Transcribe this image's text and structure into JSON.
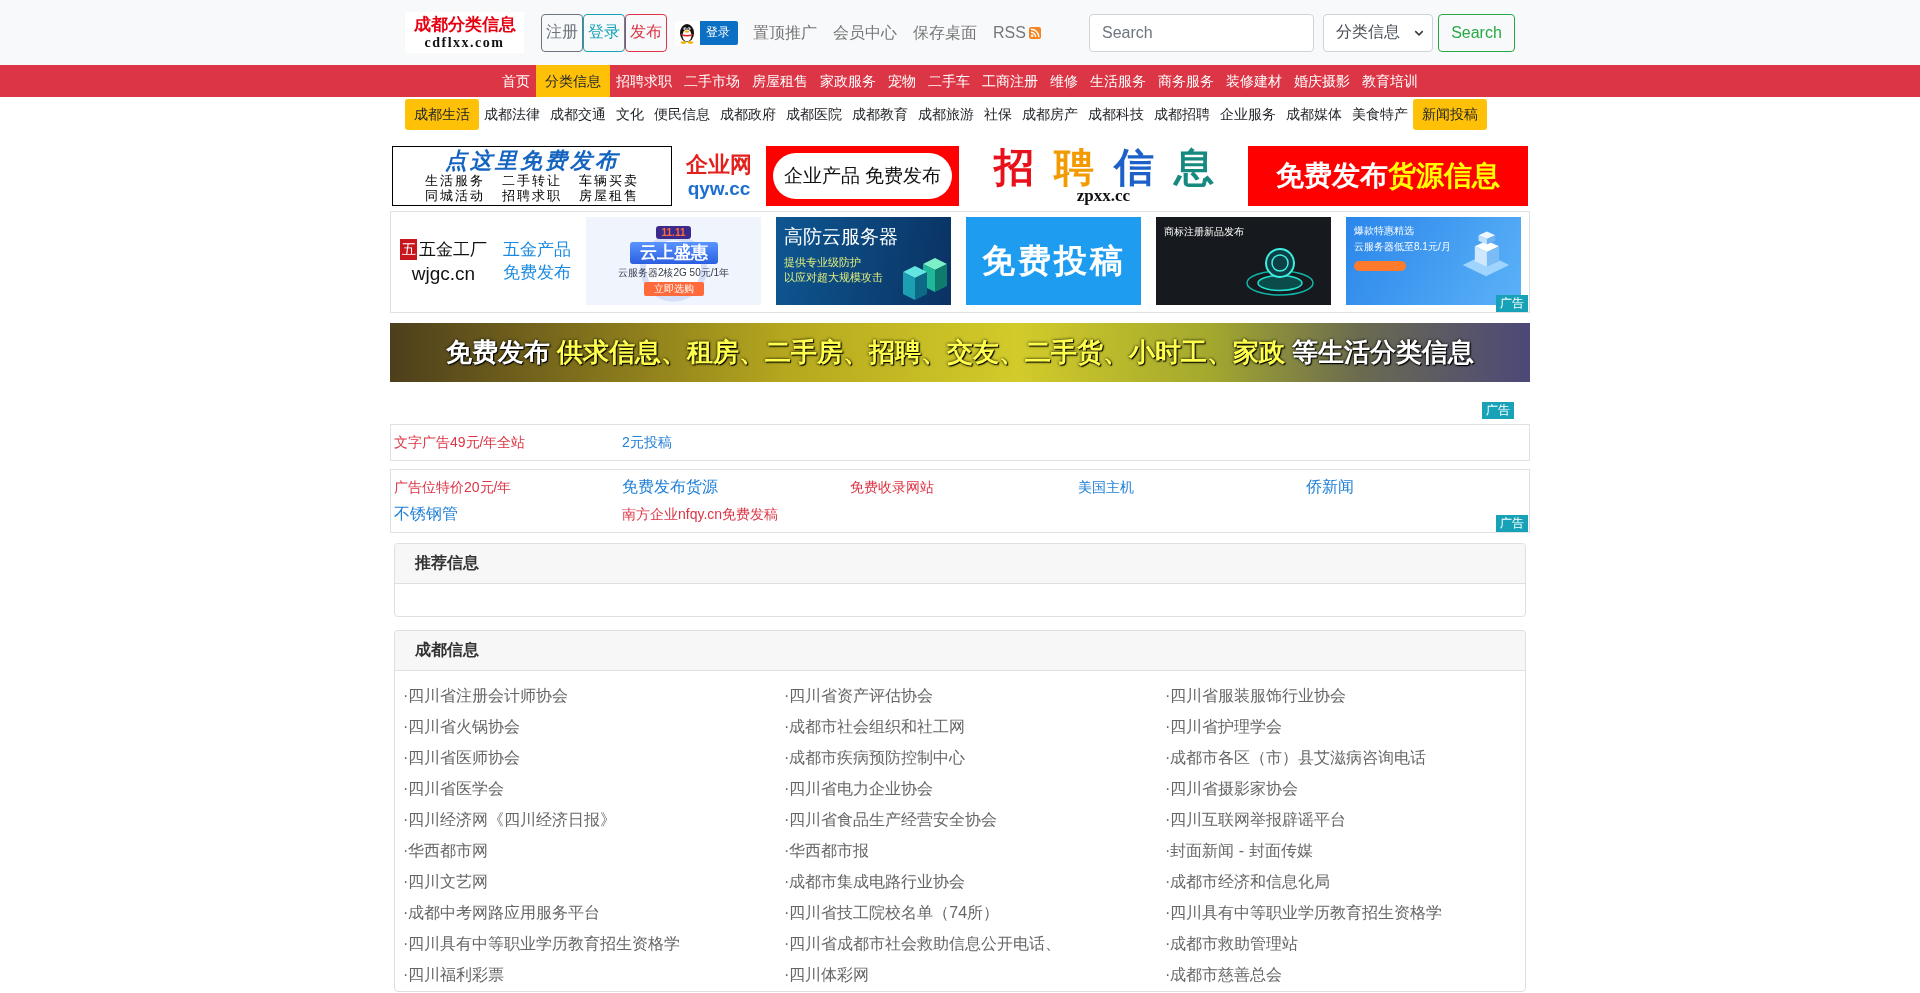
{
  "header": {
    "logo": {
      "title": "成都分类信息",
      "domain": "cdflxx.com"
    },
    "account_buttons": [
      {
        "label": "注册",
        "kind": "secondary"
      },
      {
        "label": "登录",
        "kind": "info"
      },
      {
        "label": "发布",
        "kind": "danger"
      }
    ],
    "qq_login": {
      "label": "登录"
    },
    "links": [
      {
        "label": "置顶推广",
        "kind": "text"
      },
      {
        "label": "会员中心",
        "kind": "text"
      },
      {
        "label": "保存桌面",
        "kind": "text"
      },
      {
        "label": "RSS",
        "kind": "rss"
      }
    ],
    "search": {
      "placeholder": "Search",
      "category": "分类信息",
      "button": "Search"
    }
  },
  "main_nav": [
    {
      "label": "首页",
      "selected": false
    },
    {
      "label": "分类信息",
      "selected": true
    },
    {
      "label": "招聘求职",
      "selected": false
    },
    {
      "label": "二手市场",
      "selected": false
    },
    {
      "label": "房屋租售",
      "selected": false
    },
    {
      "label": "家政服务",
      "selected": false
    },
    {
      "label": "宠物",
      "selected": false
    },
    {
      "label": "二手车",
      "selected": false
    },
    {
      "label": "工商注册",
      "selected": false
    },
    {
      "label": "维修",
      "selected": false
    },
    {
      "label": "生活服务",
      "selected": false
    },
    {
      "label": "商务服务",
      "selected": false
    },
    {
      "label": "装修建材",
      "selected": false
    },
    {
      "label": "婚庆摄影",
      "selected": false
    },
    {
      "label": "教育培训",
      "selected": false
    }
  ],
  "sub_nav": [
    {
      "label": "成都生活",
      "kind": "button"
    },
    {
      "label": "成都法律",
      "kind": "link"
    },
    {
      "label": "成都交通",
      "kind": "link"
    },
    {
      "label": "文化",
      "kind": "link"
    },
    {
      "label": "便民信息",
      "kind": "link"
    },
    {
      "label": "成都政府",
      "kind": "link"
    },
    {
      "label": "成都医院",
      "kind": "link"
    },
    {
      "label": "成都教育",
      "kind": "link"
    },
    {
      "label": "成都旅游",
      "kind": "link"
    },
    {
      "label": "社保",
      "kind": "link"
    },
    {
      "label": "成都房产",
      "kind": "link"
    },
    {
      "label": "成都科技",
      "kind": "link"
    },
    {
      "label": "成都招聘",
      "kind": "link"
    },
    {
      "label": "企业服务",
      "kind": "link"
    },
    {
      "label": "成都媒体",
      "kind": "link"
    },
    {
      "label": "美食特产",
      "kind": "link"
    },
    {
      "label": "新闻投稿",
      "kind": "button"
    }
  ],
  "banners": [
    {
      "kind": "post",
      "title": "点这里免费发布",
      "lines": [
        "生活服务 二手转让 车辆买卖",
        "同城活动 招聘求职 房屋租售"
      ]
    },
    {
      "kind": "logo",
      "title": "企业网",
      "domain": "qyw.cc"
    },
    {
      "kind": "pill",
      "title": "企业产品 免费发布"
    },
    {
      "kind": "jobs",
      "title": "招聘信息",
      "domain": "zpxx.cc"
    },
    {
      "kind": "red",
      "title": "免费发布",
      "highlight": "货源信息"
    }
  ],
  "ad_grid": {
    "tiles": [
      {
        "kind": "brand",
        "mark": "五",
        "title": "五金工厂",
        "domain": "wjgc.cn",
        "lines": [
          "五金产品",
          "免费发布"
        ]
      },
      {
        "kind": "promo",
        "badge": "11.11",
        "title": "云上盛惠",
        "text": "云服务器2核2G 50元/1年",
        "button": "立即选购"
      },
      {
        "kind": "server",
        "title": "高防云服务器",
        "lines": [
          "提供专业级防护",
          "以应对超大规模攻击"
        ]
      },
      {
        "kind": "cta",
        "title": "免费投稿"
      },
      {
        "kind": "trademark",
        "title": "商标注册新品发布"
      },
      {
        "kind": "offer",
        "lines": [
          "爆款特惠精选",
          "云服务器低至8.1元/月"
        ]
      }
    ],
    "label": "广告"
  },
  "wide_banner": {
    "lead": "免费发布",
    "highlight": "供求信息、租房、二手房、招聘、交友、二手货、小时工、家政",
    "tail": "等生活分类信息"
  },
  "text_ad_label": "广告",
  "text_ads": [
    {
      "items": [
        {
          "text": "文字广告49元/年全站",
          "kind": "link",
          "color": "#dc3545"
        },
        {
          "text": "2元投稿",
          "kind": "link",
          "color": "#1e7fd6"
        }
      ]
    },
    {
      "items": [
        {
          "text": "广告位特价20元/年",
          "kind": "link",
          "color": "#dc3545"
        },
        {
          "text": "免费发布货源",
          "kind": "headline",
          "color": "#1e7fd6"
        },
        {
          "text": "免费收录网站",
          "kind": "link",
          "color": "#dc3545"
        },
        {
          "text": "美国主机",
          "kind": "link",
          "color": "#1e7fd6"
        },
        {
          "text": "侨新闻",
          "kind": "headline",
          "color": "#1e7fd6"
        },
        {
          "text": "不锈钢管",
          "kind": "headline",
          "color": "#1e7fd6"
        },
        {
          "text": "南方企业nfqy.cn免费发稿",
          "kind": "link",
          "color": "#dc3545"
        }
      ],
      "label": "广告"
    }
  ],
  "panels": [
    {
      "title": "推荐信息"
    },
    {
      "title": "成都信息",
      "items": [
        "·四川省注册会计师协会",
        "·四川省资产评估协会",
        "·四川省服装服饰行业协会",
        "·四川省火锅协会",
        "·成都市社会组织和社工网",
        "·四川省护理学会",
        "·四川省医师协会",
        "·成都市疾病预防控制中心",
        "·成都市各区（市）县艾滋病咨询电话",
        "·四川省医学会",
        "·四川省电力企业协会",
        "·四川省摄影家协会",
        "·四川经济网《四川经济日报》",
        "·四川省食品生产经营安全协会",
        "·四川互联网举报辟谣平台",
        "·华西都市网",
        "·华西都市报",
        "·封面新闻 - 封面传媒",
        "·四川文艺网",
        "·成都市集成电路行业协会",
        "·成都市经济和信息化局",
        "·成都中考网路应用服务平台",
        "·四川省技工院校名单（74所）",
        "·四川具有中等职业学历教育招生资格学",
        "·四川具有中等职业学历教育招生资格学",
        "·四川省成都市社会救助信息公开电话、",
        "·成都市救助管理站",
        "·四川福利彩票",
        "·四川体彩网",
        "·成都市慈善总会"
      ]
    }
  ]
}
